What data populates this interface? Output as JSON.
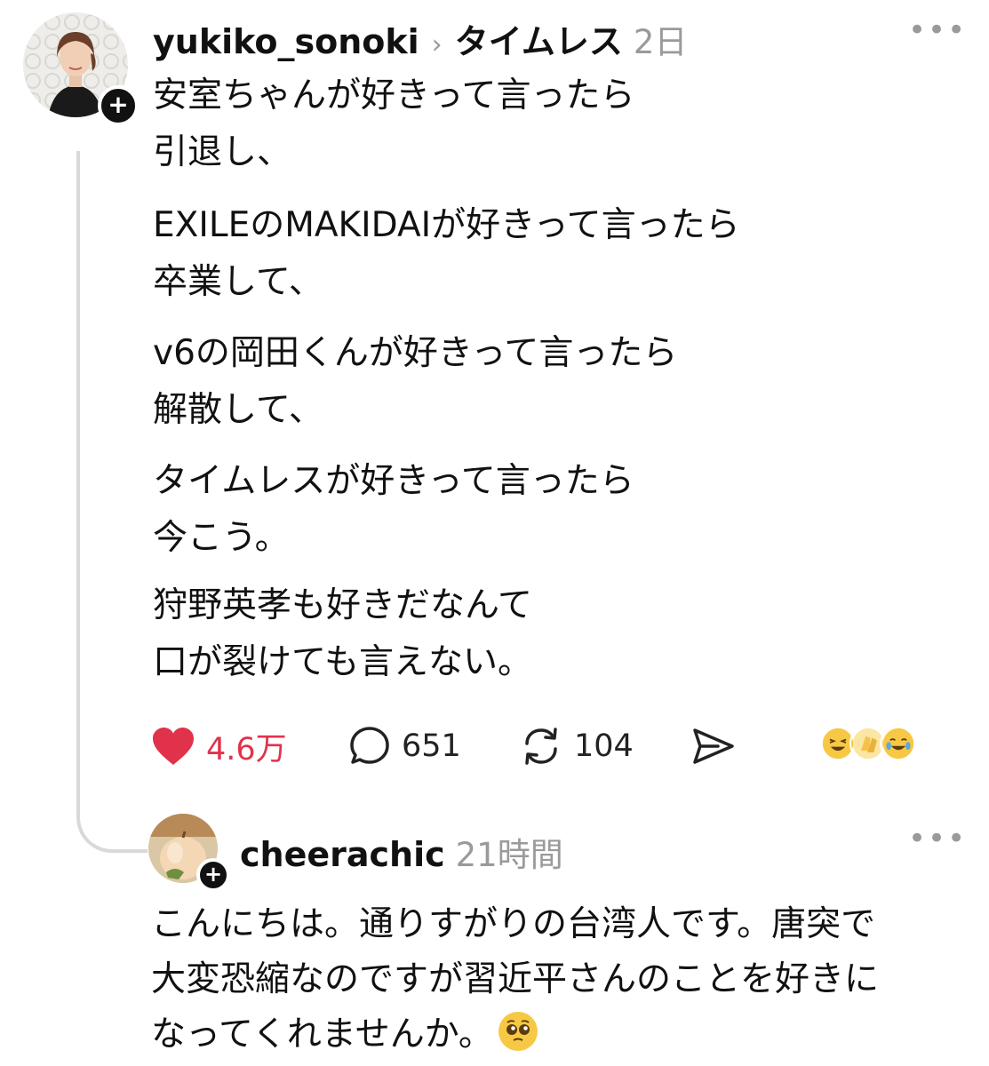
{
  "post": {
    "username": "yukiko_sonoki",
    "topic": "タイムレス",
    "time": "2日",
    "paragraphs": [
      [
        "安室ちゃんが好きって言ったら",
        "引退し、"
      ],
      [
        "EXILEのMAKIDAIが好きって言ったら",
        "卒業して、"
      ],
      [
        "v6の岡田くんが好きって言ったら",
        "解散して、"
      ],
      [
        "タイムレスが好きって言ったら",
        "今こう。"
      ],
      [
        "狩野英孝も好きだなんて",
        "口が裂けても言えない。"
      ]
    ],
    "likes": "4.6万",
    "replies": "651",
    "reposts": "104",
    "like_color": "#e0334b",
    "icons": [
      "heart-icon",
      "reply-bubble-icon",
      "repost-icon",
      "share-send-icon",
      "more-icon",
      "follow-plus-icon"
    ]
  },
  "reply": {
    "username": "cheerachic",
    "time": "21時間",
    "lines": [
      "こんにちは。通りすがりの台湾人です。唐突で",
      "大変恐縮なのですが習近平さんのことを好きに",
      "なってくれませんか。"
    ]
  }
}
